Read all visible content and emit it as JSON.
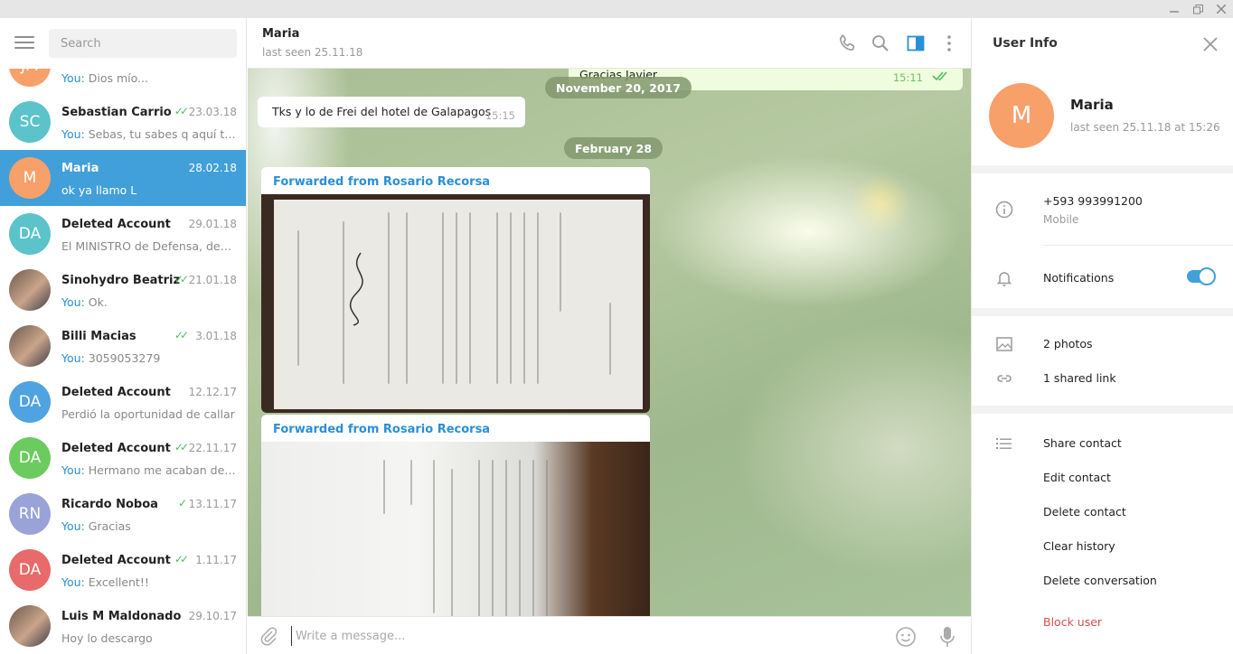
{
  "sidebar": {
    "search_placeholder": "Search",
    "chats": [
      {
        "initials": "JM",
        "name": "",
        "date": "",
        "check": "",
        "you": "You:",
        "preview": " Dios mío...",
        "color": "#f7a06a",
        "photo": false
      },
      {
        "initials": "SC",
        "name": "Sebastian Carrio",
        "date": "23.03.18",
        "check": "✓✓",
        "you": "You:",
        "preview": " Sebas, tu sabes q aquí te q...",
        "color": "#5bc3c9",
        "photo": false
      },
      {
        "initials": "M",
        "name": "Maria",
        "date": "28.02.18",
        "check": "",
        "you": "",
        "preview": "ok ya llamo L",
        "color": "#f7a06a",
        "photo": false,
        "active": true
      },
      {
        "initials": "DA",
        "name": "Deleted Account",
        "date": "29.01.18",
        "check": "",
        "you": "",
        "preview": "El MINISTRO de Defensa, defini...",
        "color": "#5bc3c9",
        "photo": false
      },
      {
        "initials": "",
        "name": "Sinohydro Beatriz",
        "date": "21.01.18",
        "check": "✓✓",
        "you": "You:",
        "preview": " Ok.",
        "color": "#9b6e63",
        "photo": true
      },
      {
        "initials": "",
        "name": "Billi Macias",
        "date": "3.01.18",
        "check": "✓✓",
        "you": "You:",
        "preview": " 3059053279",
        "color": "#7a8aa0",
        "photo": true
      },
      {
        "initials": "DA",
        "name": "Deleted Account",
        "date": "12.12.17",
        "check": "",
        "you": "",
        "preview": "Perdió la oportunidad de callar",
        "color": "#4fa3e0",
        "photo": false
      },
      {
        "initials": "DA",
        "name": "Deleted Account",
        "date": "22.11.17",
        "check": "✓✓",
        "you": "You:",
        "preview": " Hermano me acaban de ll...",
        "color": "#6ccb5f",
        "photo": false
      },
      {
        "initials": "RN",
        "name": "Ricardo Noboa",
        "date": "13.11.17",
        "check": "✓",
        "you": "You:",
        "preview": " Gracias",
        "color": "#9aa3d8",
        "photo": false
      },
      {
        "initials": "DA",
        "name": "Deleted Account",
        "date": "1.11.17",
        "check": "✓✓",
        "you": "You:",
        "preview": " Excellent!!",
        "color": "#e86a6a",
        "photo": false
      },
      {
        "initials": "",
        "name": "Luis M Maldonado",
        "date": "29.10.17",
        "check": "",
        "you": "",
        "preview": "Hoy lo descargo",
        "color": "#4e5a6a",
        "photo": true
      }
    ]
  },
  "chat": {
    "peer_name": "Maria",
    "peer_status": "last seen 25.11.18",
    "messages": {
      "out_partial_text": "Gracias Javier",
      "out_partial_time": "15:11",
      "date1": "November 20, 2017",
      "in1_text": "Tks y lo de Frei del hotel de Galapagos",
      "in1_time": "15:15",
      "date2": "February 28",
      "fwd1_title": "Forwarded from Rosario Recorsa",
      "fwd2_title": "Forwarded from Rosario Recorsa"
    },
    "composer_placeholder": "Write a message..."
  },
  "info": {
    "title": "User Info",
    "avatar_initial": "M",
    "name": "Maria",
    "last_seen": "last seen 25.11.18 at 15:26",
    "phone": "+593 993991200",
    "phone_label": "Mobile",
    "notifications_label": "Notifications",
    "notifications_on": true,
    "photos": "2 photos",
    "shared_link": "1 shared link",
    "actions": {
      "share": "Share contact",
      "edit": "Edit contact",
      "delete_contact": "Delete contact",
      "clear": "Clear history",
      "delete_conv": "Delete conversation",
      "block": "Block user"
    }
  },
  "colors": {
    "accent": "#419fd9",
    "forward_title": "#2a8fd6",
    "read_check": "#4dbb5f",
    "danger": "#d14e4e"
  }
}
